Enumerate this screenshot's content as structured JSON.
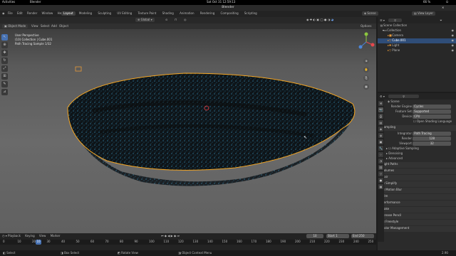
{
  "gnome": {
    "activities": "Activities",
    "app": "Blender",
    "clock": "Sat Oct 31  12:59:13",
    "battery": "66 %"
  },
  "window_title": "Blender",
  "menus": [
    "File",
    "Edit",
    "Render",
    "Window",
    "Help"
  ],
  "workspaces": [
    "Layout",
    "Modeling",
    "Sculpting",
    "UV Editing",
    "Texture Paint",
    "Shading",
    "Animation",
    "Rendering",
    "Compositing",
    "Scripting"
  ],
  "active_workspace": "Layout",
  "scene_label": "Scene",
  "view_layer_label": "View Layer",
  "viewport_header": {
    "mode": "Object Mode",
    "view": "View",
    "select": "Select",
    "add": "Add",
    "object": "Object",
    "orientation": "Global",
    "options": "Options"
  },
  "overlay": {
    "line1": "User Perspective",
    "line2": "(10) Collection | Cube.001",
    "line3": "Path Tracing Sample 1/32"
  },
  "outliner": {
    "title": "Scene Collection",
    "items": [
      {
        "name": "Collection",
        "icon": "collection-icon"
      },
      {
        "name": "Camera",
        "icon": "camera-icon"
      },
      {
        "name": "Cube.001",
        "icon": "mesh-icon"
      },
      {
        "name": "Light",
        "icon": "light-icon"
      },
      {
        "name": "Plane",
        "icon": "mesh-icon"
      }
    ]
  },
  "properties": {
    "scene_name": "Scene",
    "render_engine_label": "Render Engine",
    "render_engine": "Cycles",
    "feature_set_label": "Feature Set",
    "feature_set": "Supported",
    "device_label": "Device",
    "device": "CPU",
    "osl_label": "Open Shading Language",
    "sampling_label": "Sampling",
    "integrator_label": "Integrator",
    "integrator": "Path Tracing",
    "render_label": "Render",
    "render_samples": "128",
    "viewport_label": "Viewport",
    "viewport_samples": "32",
    "adaptive_label": "Adaptive Sampling",
    "denoising_label": "Denoising",
    "advanced_label": "Advanced",
    "panels": [
      "Light Paths",
      "Volumes",
      "Hair",
      "Simplify",
      "Motion Blur",
      "Film",
      "Performance",
      "Bake",
      "Grease Pencil",
      "Freestyle",
      "Color Management"
    ]
  },
  "timeline": {
    "menus": [
      "Playback",
      "Keying",
      "View",
      "Marker"
    ],
    "current_frame": "10",
    "start_label": "Start",
    "start": "1",
    "end_label": "End",
    "end": "250",
    "ticks": [
      "0",
      "10",
      "20",
      "30",
      "40",
      "50",
      "60",
      "70",
      "80",
      "90",
      "100",
      "110",
      "120",
      "130",
      "140",
      "150",
      "160",
      "170",
      "180",
      "190",
      "200",
      "210",
      "220",
      "230",
      "240",
      "250"
    ]
  },
  "statusbar": {
    "select": "Select",
    "box_select": "Box Select",
    "rotate_view": "Rotate View",
    "context_menu": "Object Context Menu",
    "version": "2.90"
  },
  "colors": {
    "accent": "#4772b3",
    "selection_outline": "#f5a623",
    "particles": "#3aa3d6"
  }
}
